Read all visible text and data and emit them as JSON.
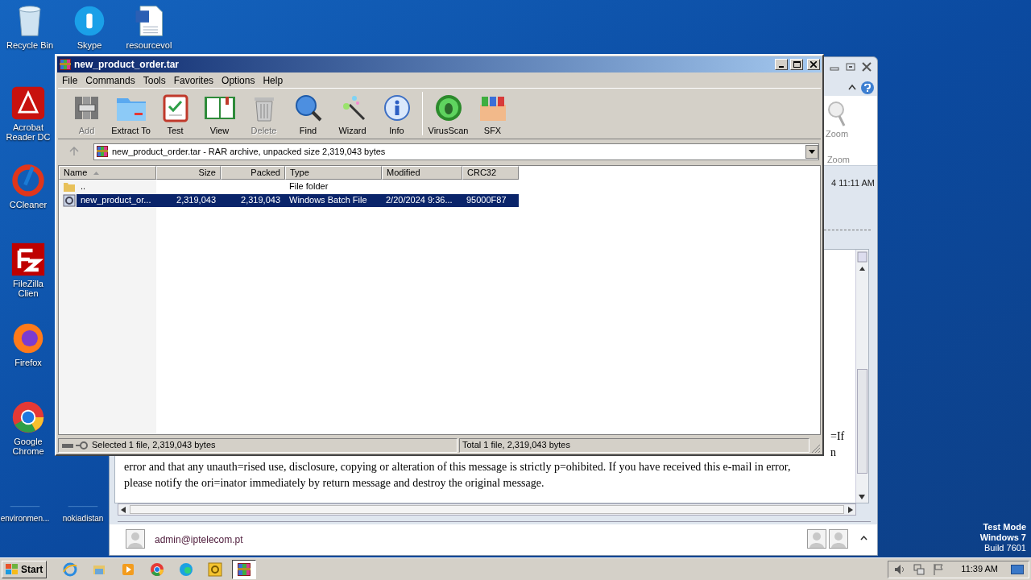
{
  "desktop_icons": [
    {
      "label": "Recycle Bin",
      "kind": "recycle"
    },
    {
      "label": "Skype",
      "kind": "skype"
    },
    {
      "label": "resourcevol",
      "kind": "word"
    },
    {
      "label": "Acrobat Reader DC",
      "kind": "acrobat"
    },
    {
      "label": "CCleaner",
      "kind": "ccleaner"
    },
    {
      "label": "FileZilla Clien",
      "kind": "filezilla"
    },
    {
      "label": "Firefox",
      "kind": "firefox"
    },
    {
      "label": "Google Chrome",
      "kind": "chrome"
    },
    {
      "label": "environmen...",
      "kind": "blank"
    },
    {
      "label": "nokiadistan",
      "kind": "blank"
    }
  ],
  "outlook": {
    "ribbon_button": "Zoom",
    "ribbon_group": "Zoom",
    "date": "4 11:11 AM",
    "body_fragments": [
      "=If",
      "n"
    ],
    "body_lines": [
      "error and that any unauth=rised use, disclosure, copying or alteration of this message is strictly p=ohibited. If you have received this e-mail in error,",
      "please notify the ori=inator immediately by return message and destroy the original message."
    ],
    "sender": "admin@iptelecom.pt"
  },
  "winrar": {
    "title": "new_product_order.tar",
    "menu": [
      "File",
      "Commands",
      "Tools",
      "Favorites",
      "Options",
      "Help"
    ],
    "toolbar": [
      {
        "label": "Add",
        "kind": "add",
        "disabled": true
      },
      {
        "label": "Extract To",
        "kind": "extract",
        "disabled": false
      },
      {
        "label": "Test",
        "kind": "test",
        "disabled": false
      },
      {
        "label": "View",
        "kind": "view",
        "disabled": false
      },
      {
        "label": "Delete",
        "kind": "delete",
        "disabled": true
      },
      {
        "label": "Find",
        "kind": "find",
        "disabled": false
      },
      {
        "label": "Wizard",
        "kind": "wizard",
        "disabled": false
      },
      {
        "label": "Info",
        "kind": "info",
        "disabled": false
      },
      {
        "label": "VirusScan",
        "kind": "virus",
        "disabled": false
      },
      {
        "label": "SFX",
        "kind": "sfx",
        "disabled": false
      }
    ],
    "address": "new_product_order.tar - RAR archive, unpacked size 2,319,043 bytes",
    "columns": [
      "Name",
      "Size",
      "Packed",
      "Type",
      "Modified",
      "CRC32"
    ],
    "rows": [
      {
        "kind": "folder",
        "cells": [
          "..",
          "",
          "",
          "File folder",
          "",
          ""
        ],
        "selected": false
      },
      {
        "kind": "batch",
        "cells": [
          "new_product_or...",
          "2,319,043",
          "2,319,043",
          "Windows Batch File",
          "2/20/2024 9:36...",
          "95000F87"
        ],
        "selected": true
      }
    ],
    "status_left": "Selected 1 file, 2,319,043 bytes",
    "status_right": "Total 1 file, 2,319,043 bytes"
  },
  "taskbar": {
    "start": "Start",
    "apps": [
      {
        "kind": "ie",
        "selected": false
      },
      {
        "kind": "explorer",
        "selected": false
      },
      {
        "kind": "media",
        "selected": false
      },
      {
        "kind": "chrome",
        "selected": false
      },
      {
        "kind": "edge",
        "selected": false
      },
      {
        "kind": "outlook",
        "selected": false
      },
      {
        "kind": "winrar",
        "selected": true
      }
    ],
    "clock": "11:39 AM"
  },
  "test_mode": [
    "Test Mode",
    "Windows 7",
    "Build 7601"
  ]
}
